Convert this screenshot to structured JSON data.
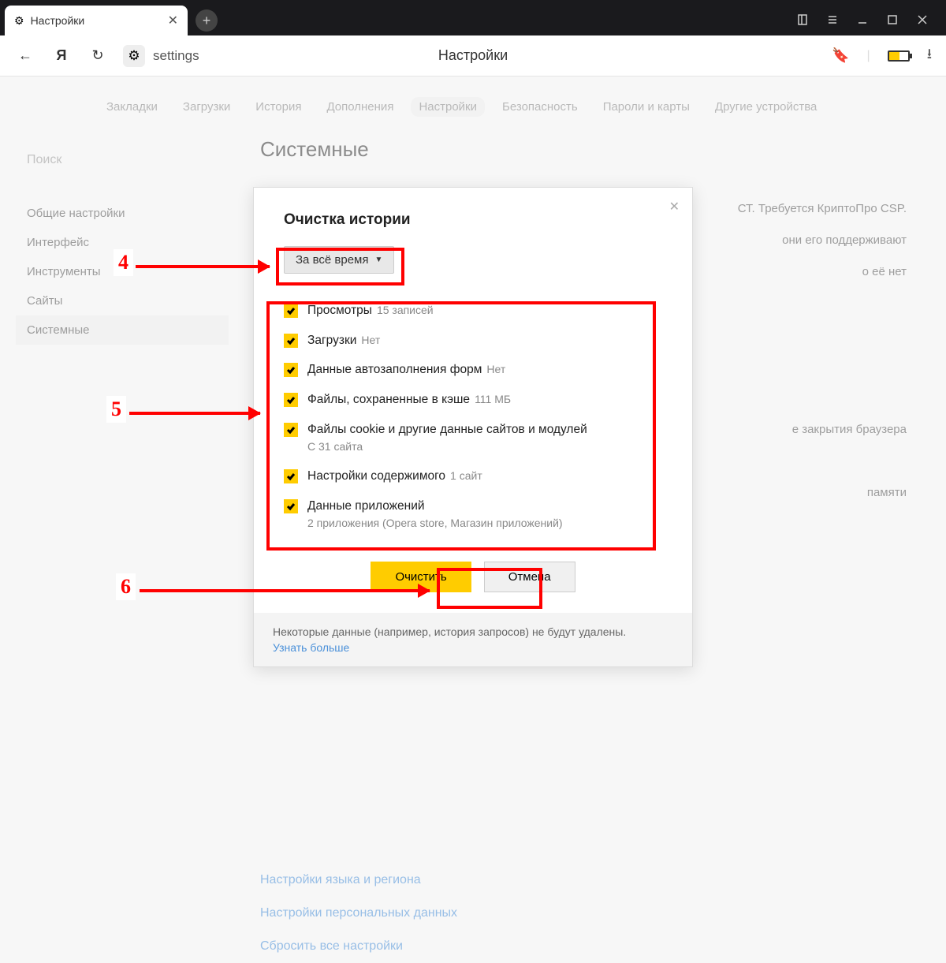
{
  "tab": {
    "title": "Настройки"
  },
  "address": {
    "url": "settings",
    "center_title": "Настройки"
  },
  "topnav": [
    "Закладки",
    "Загрузки",
    "История",
    "Дополнения",
    "Настройки",
    "Безопасность",
    "Пароли и карты",
    "Другие устройства"
  ],
  "sidebar": {
    "search_placeholder": "Поиск",
    "items": [
      "Общие настройки",
      "Интерфейс",
      "Инструменты",
      "Сайты",
      "Системные"
    ]
  },
  "main": {
    "heading": "Системные",
    "bg_lines": [
      "СТ. Требуется КриптоПро CSP.",
      "они его поддерживают",
      "о её нет",
      "е закрытия браузера",
      "памяти"
    ],
    "links": [
      "Настройки языка и региона",
      "Настройки персональных данных",
      "Сбросить все настройки"
    ]
  },
  "dialog": {
    "title": "Очистка истории",
    "dropdown": "За всё время",
    "options": [
      {
        "label": "Просмотры",
        "sub": "15 записей"
      },
      {
        "label": "Загрузки",
        "sub": "Нет"
      },
      {
        "label": "Данные автозаполнения форм",
        "sub": "Нет"
      },
      {
        "label": "Файлы, сохраненные в кэше",
        "sub": "111 МБ"
      },
      {
        "label": "Файлы cookie и другие данные сайтов и модулей",
        "subline": "С 31 сайта"
      },
      {
        "label": "Настройки содержимого",
        "sub": "1 сайт"
      },
      {
        "label": "Данные приложений",
        "subline": "2 приложения (Opera store, Магазин приложений)"
      }
    ],
    "clear": "Очистить",
    "cancel": "Отмена",
    "footer_text": "Некоторые данные (например, история запросов) не будут удалены.",
    "footer_link": "Узнать больше"
  },
  "annotations": {
    "n4": "4",
    "n5": "5",
    "n6": "6"
  }
}
